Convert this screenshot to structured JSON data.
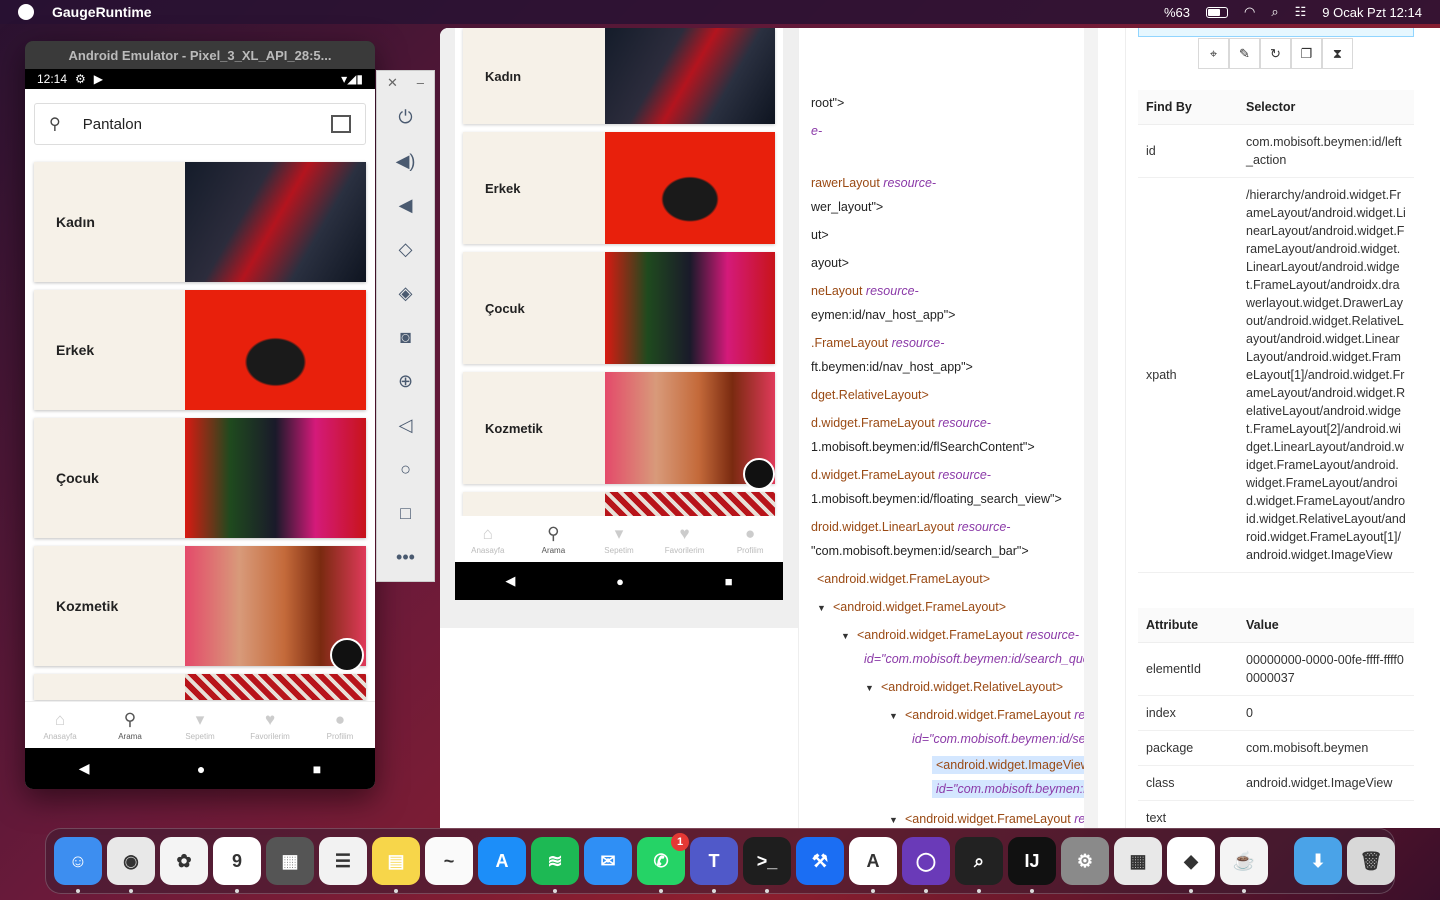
{
  "menubar": {
    "app_name": "GaugeRuntime",
    "battery": "%63",
    "datetime": "9 Ocak Pzt  12:14"
  },
  "emulator": {
    "title": "Android Emulator - Pixel_3_XL_API_28:5...",
    "status_time": "12:14",
    "search_text": "Pantalon",
    "categories": [
      "Kadın",
      "Erkek",
      "Çocuk",
      "Kozmetik"
    ],
    "tabs": [
      "Anasayfa",
      "Arama",
      "Sepetim",
      "Favorilerim",
      "Profilim"
    ],
    "active_tab": "Arama"
  },
  "sidebar": {
    "buttons": [
      "power-icon",
      "volume-up-icon",
      "volume-down-icon",
      "rotate-left-icon",
      "rotate-right-icon",
      "camera-icon",
      "zoom-icon",
      "back-icon",
      "home-icon",
      "overview-icon",
      "more-icon"
    ]
  },
  "inspector": {
    "screenshot_categories": [
      "Kadın",
      "Erkek",
      "Çocuk",
      "Kozmetik"
    ],
    "screenshot_tabs": [
      "Anasayfa",
      "Arama",
      "Sepetim",
      "Favorilerim",
      "Profilim"
    ],
    "tree": [
      {
        "text": "root\">",
        "kind": "plain"
      },
      {
        "text": "e-",
        "kind": "attr"
      },
      {
        "tag": "rawerLayout",
        "attr": "resource-"
      },
      {
        "text": "wer_layout\">",
        "kind": "plain"
      },
      {
        "text": "ut>",
        "kind": "plain"
      },
      {
        "text": "ayout>",
        "kind": "plain"
      },
      {
        "tag": "neLayout",
        "attr": "resource-"
      },
      {
        "text": "eymen:id/nav_host_app\">",
        "kind": "plain"
      },
      {
        "tag": ".FrameLayout",
        "attr": "resource-"
      },
      {
        "text": "ft.beymen:id/nav_host_app\">",
        "kind": "plain"
      },
      {
        "tag": "dget.RelativeLayout>",
        "attr": ""
      },
      {
        "tag": "d.widget.FrameLayout",
        "attr": "resource-"
      },
      {
        "text": "1.mobisoft.beymen:id/flSearchContent\">",
        "kind": "plain"
      },
      {
        "tag": "d.widget.FrameLayout",
        "attr": "resource-"
      },
      {
        "text": "1.mobisoft.beymen:id/floating_search_view\">",
        "kind": "plain"
      },
      {
        "tag": "droid.widget.LinearLayout",
        "attr": "resource-"
      },
      {
        "text": "\"com.mobisoft.beymen:id/search_bar\">",
        "kind": "plain"
      },
      {
        "tag": "<android.widget.FrameLayout>",
        "attr": ""
      },
      {
        "tag": "<android.widget.FrameLayout>",
        "attr": ""
      },
      {
        "tag": "<android.widget.FrameLayout",
        "attr": "resource-"
      },
      {
        "text": "id=\"com.mobisoft.beymen:id/search_quer",
        "kind": "id"
      },
      {
        "tag": "<android.widget.RelativeLayout>",
        "attr": ""
      },
      {
        "tag": "<android.widget.FrameLayout",
        "attr": "res"
      },
      {
        "text": "id=\"com.mobisoft.beymen:id/sea",
        "kind": "id"
      },
      {
        "tag": "<android.widget.ImageView",
        "attr": "r"
      },
      {
        "text": "id=\"com.mobisoft.beymen:id",
        "kind": "id"
      },
      {
        "tag": "<android.widget.FrameLayout",
        "attr": "res"
      }
    ],
    "selector_table": {
      "headers": [
        "Find By",
        "Selector"
      ],
      "rows": [
        [
          "id",
          "com.mobisoft.beymen:id/left_action"
        ],
        [
          "xpath",
          "/hierarchy/android.widget.FrameLayout/android.widget.LinearLayout/android.widget.FrameLayout/android.widget.LinearLayout/android.widget.FrameLayout/androidx.drawerlayout.widget.DrawerLayout/android.widget.RelativeLayout/android.widget.LinearLayout/android.widget.FrameLayout[1]/android.widget.FrameLayout/android.widget.RelativeLayout/android.widget.FrameLayout[2]/android.widget.LinearLayout/android.widget.FrameLayout/android.widget.FrameLayout/android.widget.FrameLayout/android.widget.RelativeLayout/android.widget.FrameLayout[1]/android.widget.ImageView"
        ]
      ]
    },
    "attribute_table": {
      "headers": [
        "Attribute",
        "Value"
      ],
      "rows": [
        [
          "elementId",
          "00000000-0000-00fe-ffff-ffff00000037"
        ],
        [
          "index",
          "0"
        ],
        [
          "package",
          "com.mobisoft.beymen"
        ],
        [
          "class",
          "android.widget.ImageView"
        ],
        [
          "text",
          ""
        ]
      ]
    }
  },
  "dock": {
    "apps": [
      {
        "name": "finder-icon",
        "label": "☺",
        "color": "#3d8ef0"
      },
      {
        "name": "chrome-icon",
        "label": "◉",
        "color": "#e8e8e8"
      },
      {
        "name": "photos-icon",
        "label": "✿",
        "color": "#f4f4f4"
      },
      {
        "name": "calendar-icon",
        "label": "9",
        "color": "#ffffff"
      },
      {
        "name": "calculator-icon",
        "label": "▦",
        "color": "#555555"
      },
      {
        "name": "reminders-icon",
        "label": "☰",
        "color": "#f2f2f2"
      },
      {
        "name": "notes-icon",
        "label": "▤",
        "color": "#f7d64a"
      },
      {
        "name": "freeform-icon",
        "label": "~",
        "color": "#fafafa"
      },
      {
        "name": "app-store-icon",
        "label": "A",
        "color": "#1c8ef9"
      },
      {
        "name": "spotify-icon",
        "label": "≋",
        "color": "#1db954"
      },
      {
        "name": "mail-icon",
        "label": "✉",
        "color": "#2f8ff5"
      },
      {
        "name": "whatsapp-icon",
        "label": "✆",
        "color": "#25d366"
      },
      {
        "name": "teams-icon",
        "label": "T",
        "color": "#5059c9"
      },
      {
        "name": "terminal-icon",
        "label": ">_",
        "color": "#1e1e1e"
      },
      {
        "name": "xcode-icon",
        "label": "⚒",
        "color": "#1b6ef3"
      },
      {
        "name": "appium-icon",
        "label": "A",
        "color": "#ffffff"
      },
      {
        "name": "orb-icon",
        "label": "◯",
        "color": "#6a3ab8"
      },
      {
        "name": "inspector-icon",
        "label": "⌕",
        "color": "#222222"
      },
      {
        "name": "intellij-icon",
        "label": "IJ",
        "color": "#111111"
      },
      {
        "name": "system-prefs-icon",
        "label": "⚙",
        "color": "#8a8a8a"
      },
      {
        "name": "launchpad-icon",
        "label": "▦",
        "color": "#e8e8e8"
      },
      {
        "name": "gauge-icon",
        "label": "◆",
        "color": "#ffffff"
      },
      {
        "name": "java-icon",
        "label": "☕",
        "color": "#f4f4f4"
      }
    ],
    "trailing": [
      {
        "name": "downloads-icon",
        "label": "⬇",
        "color": "#4aa3e8"
      },
      {
        "name": "trash-icon",
        "label": "🗑",
        "color": "#d8d8d8"
      }
    ],
    "whatsapp_badge": "1"
  }
}
